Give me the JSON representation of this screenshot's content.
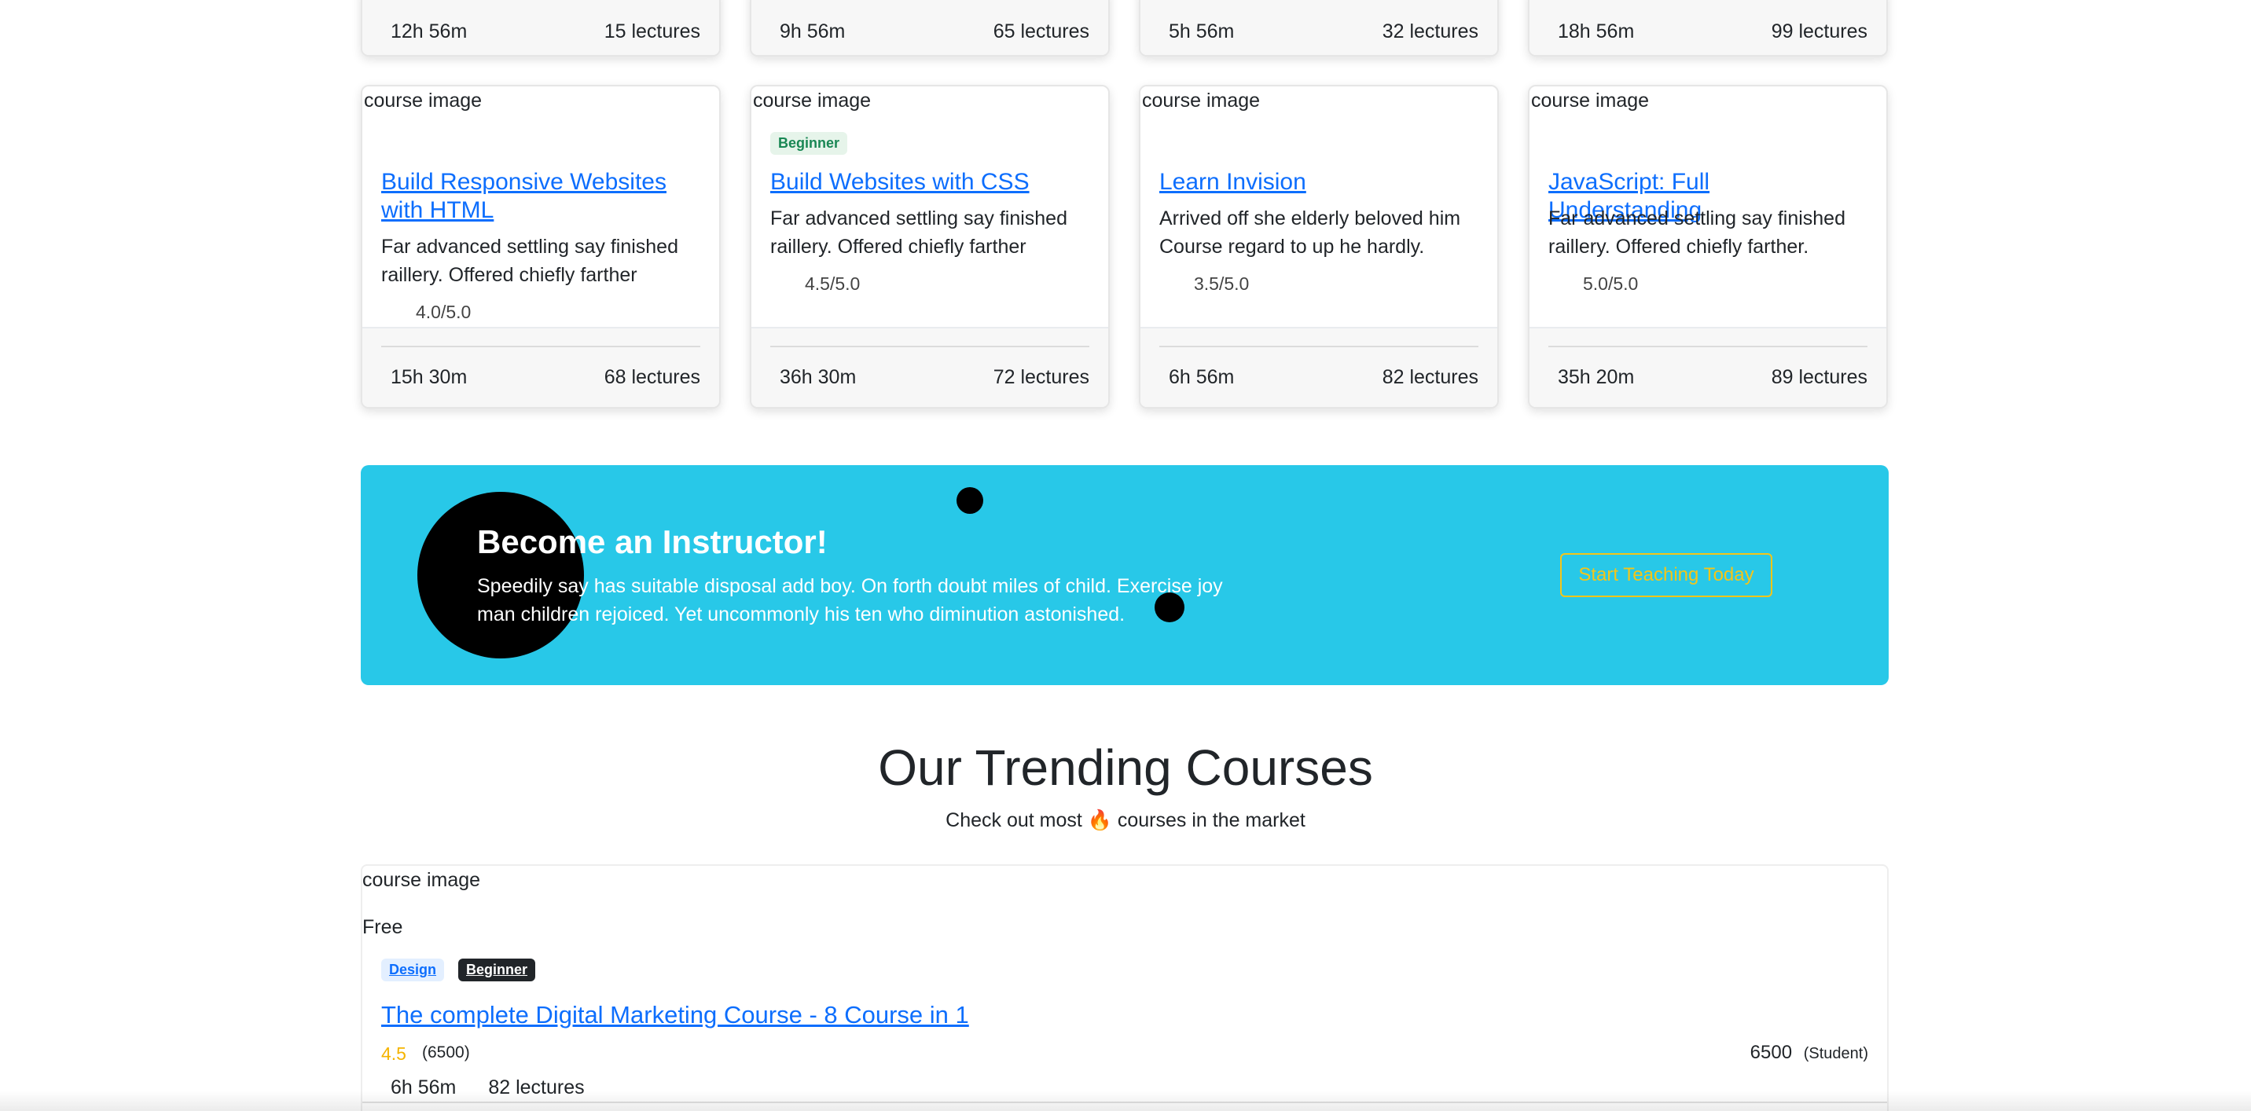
{
  "top_row": [
    {
      "duration": "12h 56m",
      "lectures": "15 lectures"
    },
    {
      "duration": "9h 56m",
      "lectures": "65 lectures"
    },
    {
      "duration": "5h 56m",
      "lectures": "32 lectures"
    },
    {
      "duration": "18h 56m",
      "lectures": "99 lectures"
    }
  ],
  "courses": [
    {
      "image_alt": "course image",
      "badge": "",
      "title": "Build Responsive Websites with HTML",
      "text": "Far advanced settling say finished raillery. Offered chiefly farther",
      "rating": "4.0/5.0",
      "duration": "15h 30m",
      "lectures": "68 lectures"
    },
    {
      "image_alt": "course image",
      "badge": "Beginner",
      "title": "Build Websites with CSS",
      "text": "Far advanced settling say finished raillery. Offered chiefly farther",
      "rating": "4.5/5.0",
      "duration": "36h 30m",
      "lectures": "72 lectures"
    },
    {
      "image_alt": "course image",
      "badge": "",
      "title": "Learn Invision",
      "text": "Arrived off she elderly beloved him Course regard to up he hardly.",
      "rating": "3.5/5.0",
      "duration": "6h 56m",
      "lectures": "82 lectures"
    },
    {
      "image_alt": "course image",
      "badge": "",
      "title": "JavaScript: Full Understanding",
      "text": "Far advanced settling say finished raillery. Offered chiefly farther.",
      "rating": "5.0/5.0",
      "duration": "35h 20m",
      "lectures": "89 lectures"
    }
  ],
  "banner": {
    "title": "Become an Instructor!",
    "text": "Speedily say has suitable disposal add boy. On forth doubt miles of child. Exercise joy man children rejoiced. Yet uncommonly his ten who diminution astonished.",
    "button": "Start Teaching Today"
  },
  "trending": {
    "title": "Our Trending Courses",
    "subtitle": "Check out most 🔥 courses in the market",
    "card": {
      "image_alt": "course image",
      "price_tag": "Free",
      "tags": [
        "Design",
        "Beginner"
      ],
      "title": "The complete Digital Marketing Course - 8 Course in 1",
      "rating": "4.5",
      "rating_count": "(6500)",
      "students": "6500",
      "students_label": "(Student)",
      "duration": "6h 56m",
      "lectures": "82 lectures"
    }
  },
  "colors": {
    "banner_bg": "#28c8e8",
    "link": "#0d6efd",
    "accent_yellow": "#f5c518"
  }
}
